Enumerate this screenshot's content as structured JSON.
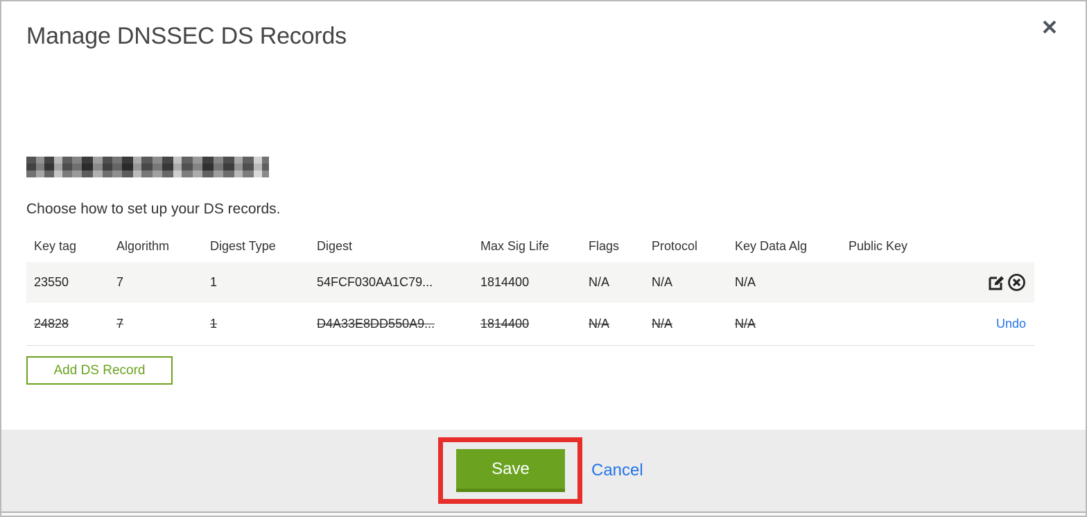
{
  "dialog": {
    "title": "Manage DNSSEC DS Records",
    "instruction": "Choose how to set up your DS records.",
    "domain": "(redacted / pixelated domain name)"
  },
  "table": {
    "headers": [
      "Key tag",
      "Algorithm",
      "Digest Type",
      "Digest",
      "Max Sig Life",
      "Flags",
      "Protocol",
      "Key Data Alg",
      "Public Key"
    ],
    "rows": [
      {
        "key_tag": "23550",
        "algorithm": "7",
        "digest_type": "1",
        "digest": "54FCF030AA1C79...",
        "max_sig_life": "1814400",
        "flags": "N/A",
        "protocol": "N/A",
        "key_data_alg": "N/A",
        "public_key": "",
        "state": "active",
        "actions": [
          "edit",
          "delete"
        ]
      },
      {
        "key_tag": "24828",
        "algorithm": "7",
        "digest_type": "1",
        "digest": "D4A33E8DD550A9...",
        "max_sig_life": "1814400",
        "flags": "N/A",
        "protocol": "N/A",
        "key_data_alg": "N/A",
        "public_key": "",
        "state": "deleted",
        "undo_label": "Undo"
      }
    ]
  },
  "buttons": {
    "add_ds_record": "Add DS Record",
    "save": "Save",
    "cancel": "Cancel"
  },
  "icons": {
    "close": "x-icon",
    "edit": "edit-pencil-square-icon",
    "delete": "x-in-circle-icon"
  },
  "colors": {
    "green_accent": "#6aa21d",
    "save_green": "#6ba321",
    "link_blue": "#2574e8",
    "annotation_red": "#e62e2a",
    "footer_gray": "#ececec",
    "row_gray": "#f5f5f4",
    "title_gray": "#454545"
  }
}
